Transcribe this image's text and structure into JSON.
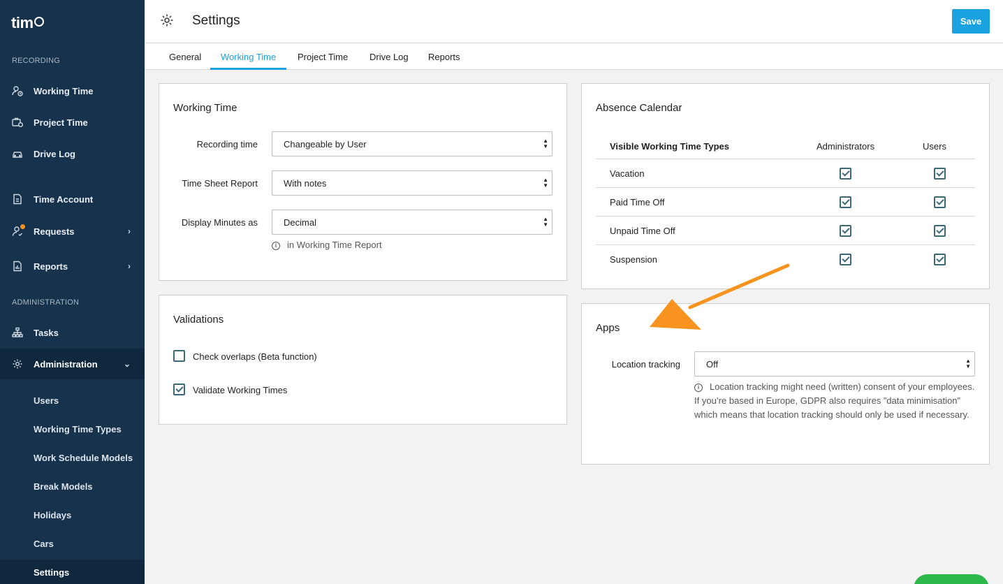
{
  "app": {
    "logo_text": "tim",
    "accent_color": "#1aa1e0",
    "sidebar_color": "#17324d"
  },
  "sidebar": {
    "section_recording": "RECORDING",
    "section_administration": "ADMINISTRATION",
    "items": [
      {
        "label": "Working Time",
        "icon": "user-clock-icon"
      },
      {
        "label": "Project Time",
        "icon": "briefcase-clock-icon"
      },
      {
        "label": "Drive Log",
        "icon": "car-icon"
      },
      {
        "label": "Time Account",
        "icon": "document-icon"
      },
      {
        "label": "Requests",
        "icon": "user-request-icon"
      },
      {
        "label": "Reports",
        "icon": "report-icon"
      },
      {
        "label": "Tasks",
        "icon": "hierarchy-icon"
      },
      {
        "label": "Administration",
        "icon": "gear-icon"
      }
    ],
    "admin_sub_items": [
      {
        "label": "Users"
      },
      {
        "label": "Working Time Types"
      },
      {
        "label": "Work Schedule Models"
      },
      {
        "label": "Break Models"
      },
      {
        "label": "Holidays"
      },
      {
        "label": "Cars"
      },
      {
        "label": "Settings"
      }
    ]
  },
  "header": {
    "title": "Settings",
    "save_label": "Save"
  },
  "tabs": [
    {
      "label": "General"
    },
    {
      "label": "Working Time"
    },
    {
      "label": "Project Time"
    },
    {
      "label": "Drive Log"
    },
    {
      "label": "Reports"
    }
  ],
  "working_time_card": {
    "title": "Working Time",
    "fields": [
      {
        "label": "Recording time",
        "value": "Changeable by User"
      },
      {
        "label": "Time Sheet Report",
        "value": "With notes"
      },
      {
        "label": "Display Minutes as",
        "value": "Decimal"
      }
    ],
    "hint": "in Working Time Report"
  },
  "validations_card": {
    "title": "Validations",
    "checkboxes": [
      {
        "label": "Check overlaps (Beta function)",
        "checked": false
      },
      {
        "label": "Validate Working Times",
        "checked": true
      }
    ]
  },
  "absence_card": {
    "title": "Absence Calendar",
    "headers": {
      "name": "Visible Working Time Types",
      "admins": "Administrators",
      "users": "Users"
    },
    "rows": [
      {
        "name": "Vacation",
        "admins": true,
        "users": true
      },
      {
        "name": "Paid Time Off",
        "admins": true,
        "users": true
      },
      {
        "name": "Unpaid Time Off",
        "admins": true,
        "users": true
      },
      {
        "name": "Suspension",
        "admins": true,
        "users": true
      }
    ]
  },
  "apps_card": {
    "title": "Apps",
    "field_label": "Location tracking",
    "field_value": "Off",
    "hint": "Location tracking might need (written) consent of your employees. If you’re based in Europe, GDPR also requires ”data minimisation” which means that location tracking should only be used if necessary."
  },
  "annotation": {
    "arrow_color": "#f7931e"
  }
}
